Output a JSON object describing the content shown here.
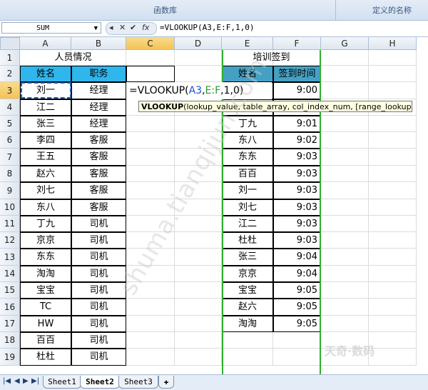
{
  "ribbon": {
    "group1": "函数库",
    "group2": "定义的名称"
  },
  "formula_bar": {
    "name_box": "SUM",
    "fx": "fx",
    "formula": "=VLOOKUP(A3,E:F,1,0)"
  },
  "columns": [
    "A",
    "B",
    "C",
    "D",
    "E",
    "F",
    "G",
    "H"
  ],
  "rows": [
    "1",
    "2",
    "3",
    "4",
    "5",
    "6",
    "7",
    "8",
    "9",
    "10",
    "11",
    "12",
    "13",
    "14",
    "15",
    "16",
    "17",
    "18",
    "19"
  ],
  "left_table": {
    "title": "人员情况",
    "headers": [
      "姓名",
      "职务"
    ],
    "rows": [
      [
        "刘一",
        "经理"
      ],
      [
        "江二",
        "经理"
      ],
      [
        "张三",
        "经理"
      ],
      [
        "李四",
        "客服"
      ],
      [
        "王五",
        "客服"
      ],
      [
        "赵六",
        "客服"
      ],
      [
        "刘七",
        "客服"
      ],
      [
        "东八",
        "客服"
      ],
      [
        "丁九",
        "司机"
      ],
      [
        "京京",
        "司机"
      ],
      [
        "东东",
        "司机"
      ],
      [
        "淘淘",
        "司机"
      ],
      [
        "宝宝",
        "司机"
      ],
      [
        "TC",
        "司机"
      ],
      [
        "HW",
        "司机"
      ],
      [
        "百百",
        "司机"
      ],
      [
        "杜杜",
        "司机"
      ]
    ]
  },
  "right_table": {
    "title": "培训签到",
    "headers": [
      "姓名",
      "签到时间"
    ],
    "rows": [
      [
        "",
        "9:00"
      ],
      [
        "",
        ""
      ],
      [
        "丁九",
        "9:01"
      ],
      [
        "东八",
        "9:02"
      ],
      [
        "东东",
        "9:03"
      ],
      [
        "百百",
        "9:03"
      ],
      [
        "刘一",
        "9:03"
      ],
      [
        "刘七",
        "9:03"
      ],
      [
        "江二",
        "9:03"
      ],
      [
        "杜杜",
        "9:03"
      ],
      [
        "张三",
        "9:04"
      ],
      [
        "京京",
        "9:04"
      ],
      [
        "宝宝",
        "9:05"
      ],
      [
        "赵六",
        "9:05"
      ],
      [
        "淘淘",
        "9:05"
      ]
    ]
  },
  "editing": {
    "prefix": "=VLOOKUP(",
    "arg1": "A3",
    "comma1": ",",
    "arg2": "E:F",
    "rest": ",1,0)"
  },
  "tooltip": {
    "fn": "VLOOKUP",
    "args": "(lookup_value, table_array, col_index_num, [range_lookup])"
  },
  "sheet_tabs": [
    "Sheet1",
    "Sheet2",
    "Sheet3"
  ],
  "watermark": "shuma.tianqijun.com",
  "logo": "天奇·数码"
}
